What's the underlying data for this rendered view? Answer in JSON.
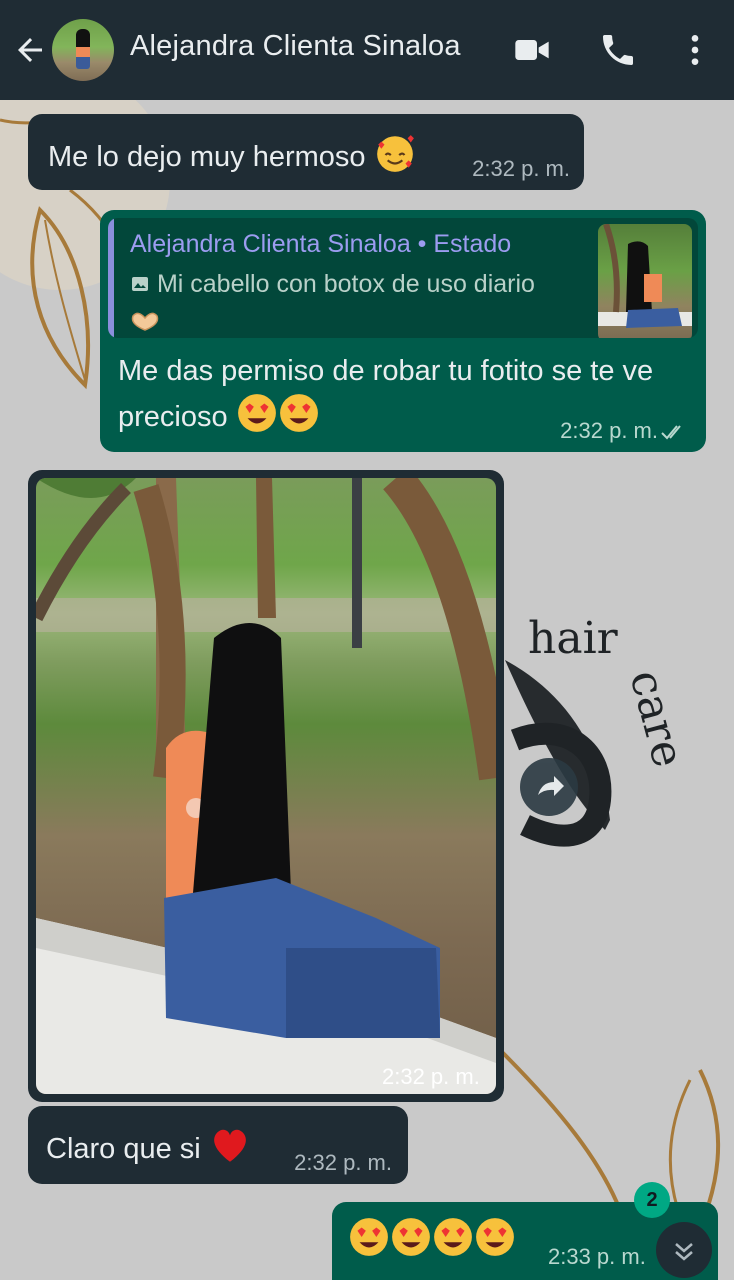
{
  "header": {
    "title": "Alejandra Clienta Sinaloa",
    "icons": [
      "back-arrow-icon",
      "video-call-icon",
      "phone-call-icon",
      "more-options-icon"
    ]
  },
  "wallpaper": {
    "brand_text_1": "hair",
    "brand_text_2": "care"
  },
  "messages": [
    {
      "type": "incoming",
      "text": "Me lo dejo muy hermoso",
      "emoji": "smiling-face-with-hearts",
      "time": "2:32 p. m."
    },
    {
      "type": "outgoing",
      "reply": {
        "author": "Alejandra Clienta Sinaloa • Estado",
        "text": "Mi cabello con botox de uso diario"
      },
      "text": "Me das permiso de robar tu fotito se te ve precioso",
      "time": "2:32 p. m.",
      "status": "read"
    },
    {
      "type": "incoming-image",
      "time": "2:32 p. m."
    },
    {
      "type": "incoming",
      "text": "Claro que si",
      "emoji": "red-heart",
      "time": "2:32 p. m."
    },
    {
      "type": "outgoing",
      "text": "",
      "emoji_count": 4,
      "time": "2:33 p. m."
    }
  ],
  "unread_count": "2",
  "colors": {
    "header": "#1f2c34",
    "incoming": "#1f2c34",
    "outgoing": "#005c4b",
    "accent": "#00a884",
    "wallpaper": "#c9c9c9"
  }
}
